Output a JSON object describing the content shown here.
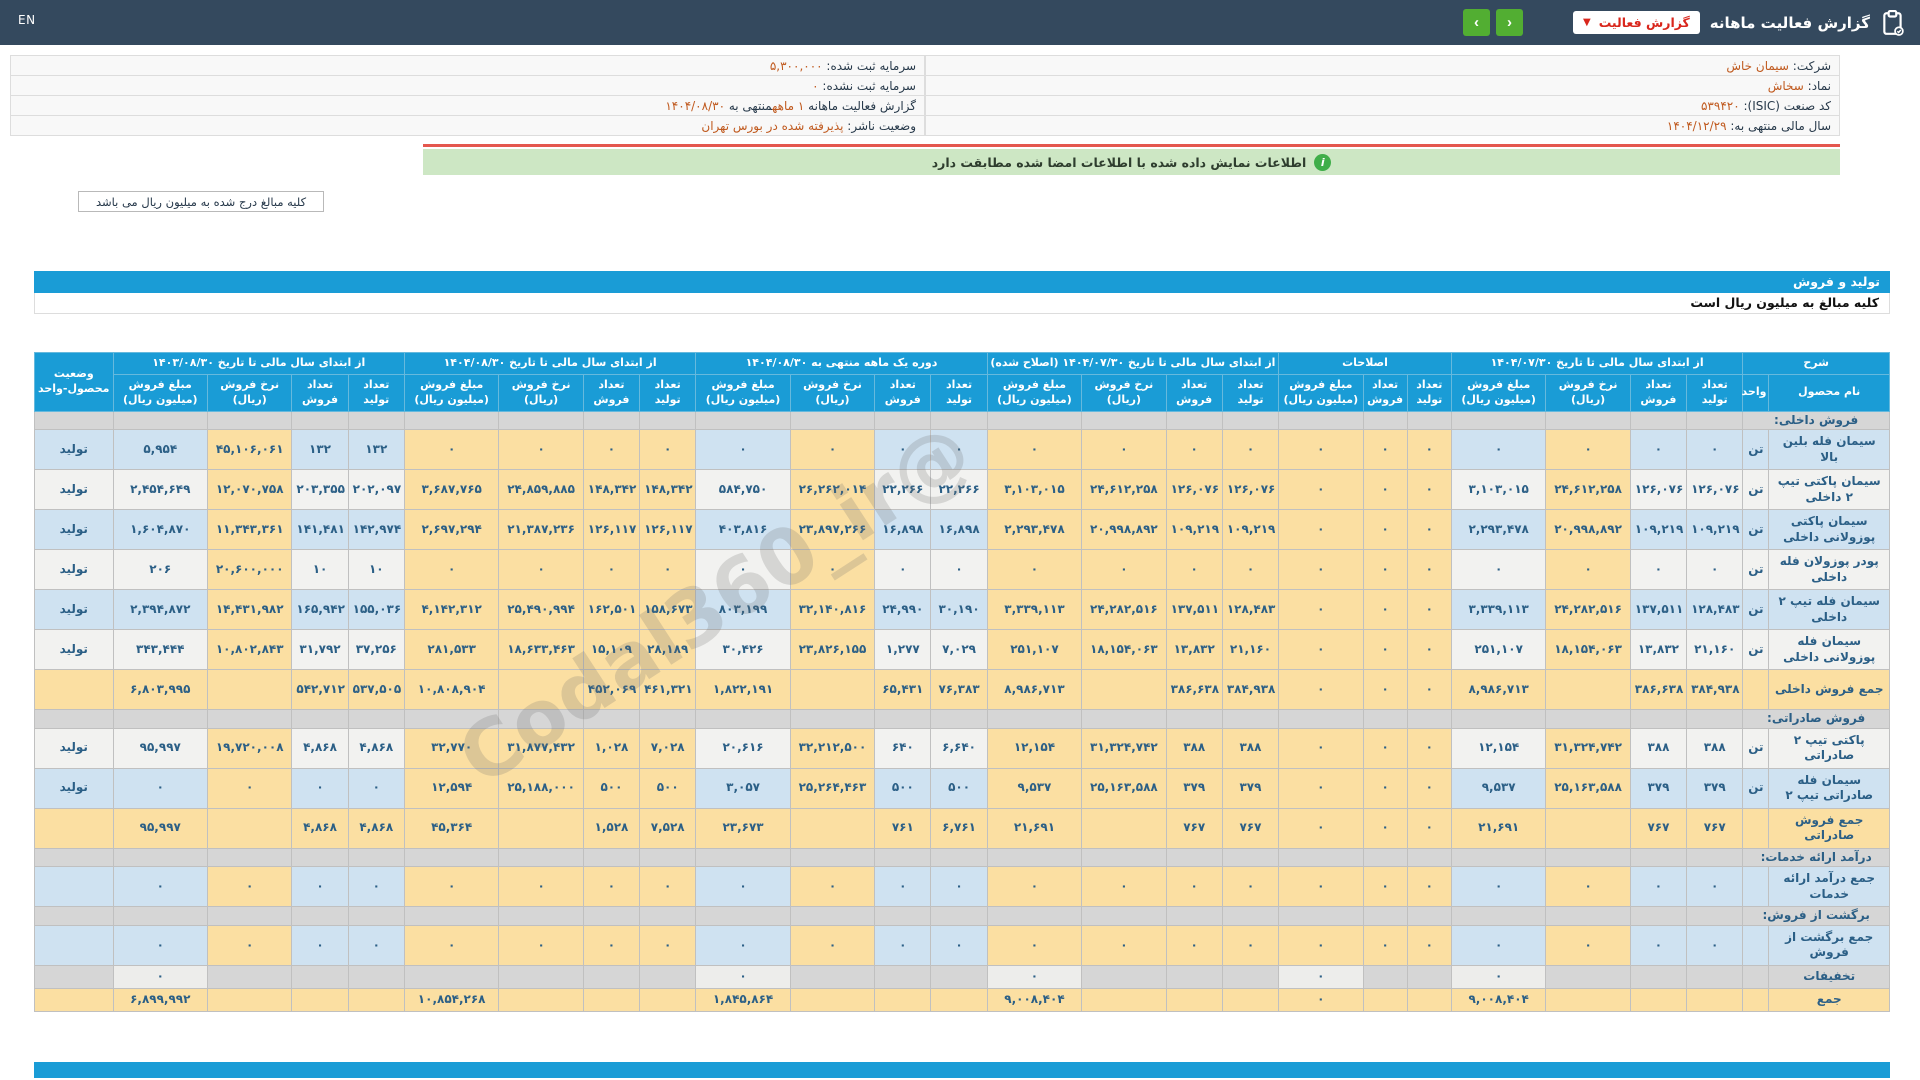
{
  "colors": {
    "topbar": "#34495e",
    "accent_blue": "#1a9cd6",
    "green_button": "#52ae32",
    "red_accent": "#d9261c",
    "orange_value": "#c05a1f",
    "row_blue": "#cfe2f1",
    "row_gray": "#f2f2f0",
    "cell_yellow": "#fbdfa2",
    "section_gray": "#d6d6d6",
    "green_bar": "#cde7c4",
    "red_line": "#e4574e"
  },
  "topbar": {
    "title": "گزارش فعالیت ماهانه",
    "dropdown_label": "گزارش فعالیت",
    "prev_label": "‹",
    "next_label": "›",
    "en_label": "EN"
  },
  "info": {
    "right": [
      {
        "label": "شرکت:",
        "value": "سیمان خاش"
      },
      {
        "label": "نماد:",
        "value": "سخاش"
      },
      {
        "label": "کد صنعت (ISIC):",
        "value": "۵۳۹۴۲۰"
      },
      {
        "label": "سال مالی منتهی به:",
        "value": "۱۴۰۴/۱۲/۲۹"
      }
    ],
    "left": [
      {
        "label": "سرمایه ثبت شده:",
        "value": "۵,۳۰۰,۰۰۰"
      },
      {
        "label": "سرمایه ثبت نشده:",
        "value": "۰"
      },
      {
        "parts": [
          {
            "t": "گزارش فعالیت ماهانه "
          },
          {
            "t": "۱ ماهه",
            "o": true
          },
          {
            "t": "منتهی به "
          },
          {
            "t": "۱۴۰۴/۰۸/۳۰",
            "o": true
          }
        ]
      },
      {
        "label": "وضعیت ناشر:",
        "value": "پذیرفته شده در بورس تهران"
      }
    ]
  },
  "signature_note": "اطلاعات نمایش داده شده با اطلاعات امضا شده مطابقت دارد",
  "info_icon": "i",
  "amounts_note_box": "کلیه مبالغ درج شده به میلیون ریال می باشد",
  "section_bar": "تولید و فروش",
  "table_note": "کلیه مبالغ به میلیون ریال است",
  "watermark": "@Codal360_ir",
  "table": {
    "header": {
      "sharh": "شرح",
      "name_col": "نام محصول",
      "unit_col": "واحد",
      "status_col": "وضعیت محصول-واحد",
      "sub4": [
        "تعداد تولید",
        "تعداد فروش",
        "نرخ فروش (ریال)",
        "مبلغ فروش (میلیون ریال)"
      ],
      "sub3": [
        "تعداد تولید",
        "تعداد فروش",
        "مبلغ فروش (میلیون ریال)"
      ],
      "groups": [
        {
          "key": "g07",
          "cols": 4,
          "label": "از ابتدای سال مالی تا تاریخ ۱۴۰۴/۰۷/۳۰"
        },
        {
          "key": "amd",
          "cols": 3,
          "label": "اصلاحات"
        },
        {
          "key": "g07c",
          "cols": 4,
          "label": "از ابتدای سال مالی تا تاریخ ۱۴۰۴/۰۷/۳۰ (اصلاح شده)"
        },
        {
          "key": "m1",
          "cols": 4,
          "label": "دوره یک ماهه منتهی به ۱۴۰۴/۰۸/۳۰"
        },
        {
          "key": "g08",
          "cols": 4,
          "label": "از ابتدای سال مالی تا تاریخ ۱۴۰۴/۰۸/۳۰"
        },
        {
          "key": "g03",
          "cols": 4,
          "label": "از ابتدای سال مالی تا تاریخ ۱۴۰۳/۰۸/۳۰"
        }
      ]
    },
    "rows": [
      {
        "type": "section",
        "name": "فروش داخلی:"
      },
      {
        "type": "data",
        "tone": "blue",
        "name": "سیمان فله بلین بالا",
        "unit": "تن",
        "status": "تولید",
        "g07": [
          "۰",
          "۰",
          "۰",
          "۰"
        ],
        "amd": [
          "۰",
          "۰",
          "۰"
        ],
        "g07c": [
          "۰",
          "۰",
          "۰",
          "۰"
        ],
        "m1": [
          "۰",
          "۰",
          "۰",
          "۰"
        ],
        "g08": [
          "۰",
          "۰",
          "۰",
          "۰"
        ],
        "g03": [
          "۱۳۲",
          "۱۳۲",
          "۴۵,۱۰۶,۰۶۱",
          "۵,۹۵۴"
        ]
      },
      {
        "type": "data",
        "tone": "gray",
        "name": "سیمان پاکتی تیپ ۲ داخلی",
        "unit": "تن",
        "status": "تولید",
        "g07": [
          "۱۲۶,۰۷۶",
          "۱۲۶,۰۷۶",
          "۲۴,۶۱۲,۲۵۸",
          "۳,۱۰۳,۰۱۵"
        ],
        "amd": [
          "۰",
          "۰",
          "۰"
        ],
        "g07c": [
          "۱۲۶,۰۷۶",
          "۱۲۶,۰۷۶",
          "۲۴,۶۱۲,۲۵۸",
          "۳,۱۰۳,۰۱۵"
        ],
        "m1": [
          "۲۲,۲۶۶",
          "۲۲,۲۶۶",
          "۲۶,۲۶۲,۰۱۴",
          "۵۸۴,۷۵۰"
        ],
        "g08": [
          "۱۴۸,۳۴۲",
          "۱۴۸,۳۴۲",
          "۲۴,۸۵۹,۸۸۵",
          "۳,۶۸۷,۷۶۵"
        ],
        "g03": [
          "۲۰۲,۰۹۷",
          "۲۰۳,۳۵۵",
          "۱۲,۰۷۰,۷۵۸",
          "۲,۴۵۴,۶۴۹"
        ]
      },
      {
        "type": "data",
        "tone": "blue",
        "name": "سیمان پاکتی پوزولانی داخلی",
        "unit": "تن",
        "status": "تولید",
        "g07": [
          "۱۰۹,۲۱۹",
          "۱۰۹,۲۱۹",
          "۲۰,۹۹۸,۸۹۲",
          "۲,۲۹۳,۴۷۸"
        ],
        "amd": [
          "۰",
          "۰",
          "۰"
        ],
        "g07c": [
          "۱۰۹,۲۱۹",
          "۱۰۹,۲۱۹",
          "۲۰,۹۹۸,۸۹۲",
          "۲,۲۹۳,۴۷۸"
        ],
        "m1": [
          "۱۶,۸۹۸",
          "۱۶,۸۹۸",
          "۲۳,۸۹۷,۲۶۶",
          "۴۰۳,۸۱۶"
        ],
        "g08": [
          "۱۲۶,۱۱۷",
          "۱۲۶,۱۱۷",
          "۲۱,۳۸۷,۲۳۶",
          "۲,۶۹۷,۲۹۴"
        ],
        "g03": [
          "۱۴۲,۹۷۴",
          "۱۴۱,۴۸۱",
          "۱۱,۳۴۳,۳۶۱",
          "۱,۶۰۴,۸۷۰"
        ]
      },
      {
        "type": "data",
        "tone": "gray",
        "name": "پودر پوزولان فله داخلی",
        "unit": "تن",
        "status": "تولید",
        "g07": [
          "۰",
          "۰",
          "۰",
          "۰"
        ],
        "amd": [
          "۰",
          "۰",
          "۰"
        ],
        "g07c": [
          "۰",
          "۰",
          "۰",
          "۰"
        ],
        "m1": [
          "۰",
          "۰",
          "۰",
          "۰"
        ],
        "g08": [
          "۰",
          "۰",
          "۰",
          "۰"
        ],
        "g03": [
          "۱۰",
          "۱۰",
          "۲۰,۶۰۰,۰۰۰",
          "۲۰۶"
        ]
      },
      {
        "type": "data",
        "tone": "blue",
        "name": "سیمان فله تیپ ۲ داخلی",
        "unit": "تن",
        "status": "تولید",
        "g07": [
          "۱۲۸,۴۸۳",
          "۱۳۷,۵۱۱",
          "۲۴,۲۸۲,۵۱۶",
          "۳,۳۳۹,۱۱۳"
        ],
        "amd": [
          "۰",
          "۰",
          "۰"
        ],
        "g07c": [
          "۱۲۸,۴۸۳",
          "۱۳۷,۵۱۱",
          "۲۴,۲۸۲,۵۱۶",
          "۳,۳۳۹,۱۱۳"
        ],
        "m1": [
          "۳۰,۱۹۰",
          "۲۴,۹۹۰",
          "۳۲,۱۴۰,۸۱۶",
          "۸۰۳,۱۹۹"
        ],
        "g08": [
          "۱۵۸,۶۷۳",
          "۱۶۲,۵۰۱",
          "۲۵,۴۹۰,۹۹۴",
          "۴,۱۴۲,۳۱۲"
        ],
        "g03": [
          "۱۵۵,۰۳۶",
          "۱۶۵,۹۴۲",
          "۱۴,۴۳۱,۹۸۲",
          "۲,۳۹۴,۸۷۲"
        ]
      },
      {
        "type": "data",
        "tone": "gray",
        "name": "سیمان فله پوزولانی داخلی",
        "unit": "تن",
        "status": "تولید",
        "g07": [
          "۲۱,۱۶۰",
          "۱۳,۸۳۲",
          "۱۸,۱۵۴,۰۶۳",
          "۲۵۱,۱۰۷"
        ],
        "amd": [
          "۰",
          "۰",
          "۰"
        ],
        "g07c": [
          "۲۱,۱۶۰",
          "۱۳,۸۳۲",
          "۱۸,۱۵۴,۰۶۳",
          "۲۵۱,۱۰۷"
        ],
        "m1": [
          "۷,۰۲۹",
          "۱,۲۷۷",
          "۲۳,۸۲۶,۱۵۵",
          "۳۰,۴۲۶"
        ],
        "g08": [
          "۲۸,۱۸۹",
          "۱۵,۱۰۹",
          "۱۸,۶۳۳,۴۶۳",
          "۲۸۱,۵۳۳"
        ],
        "g03": [
          "۳۷,۲۵۶",
          "۳۱,۷۹۲",
          "۱۰,۸۰۲,۸۴۳",
          "۳۴۳,۴۴۴"
        ]
      },
      {
        "type": "total",
        "name": "جمع فروش داخلی",
        "unit": "",
        "status": "",
        "g07": [
          "۳۸۴,۹۳۸",
          "۳۸۶,۶۳۸",
          "",
          "۸,۹۸۶,۷۱۳"
        ],
        "amd": [
          "۰",
          "۰",
          "۰"
        ],
        "g07c": [
          "۳۸۴,۹۳۸",
          "۳۸۶,۶۳۸",
          "",
          "۸,۹۸۶,۷۱۳"
        ],
        "m1": [
          "۷۶,۳۸۳",
          "۶۵,۴۳۱",
          "",
          "۱,۸۲۲,۱۹۱"
        ],
        "g08": [
          "۴۶۱,۳۲۱",
          "۴۵۲,۰۶۹",
          "",
          "۱۰,۸۰۸,۹۰۴"
        ],
        "g03": [
          "۵۳۷,۵۰۵",
          "۵۴۲,۷۱۲",
          "",
          "۶,۸۰۳,۹۹۵"
        ]
      },
      {
        "type": "section",
        "name": "فروش صادراتی:"
      },
      {
        "type": "data",
        "tone": "gray",
        "name": "پاکتی تیپ ۲ صادراتی",
        "unit": "تن",
        "status": "تولید",
        "g07": [
          "۳۸۸",
          "۳۸۸",
          "۳۱,۳۲۴,۷۴۲",
          "۱۲,۱۵۴"
        ],
        "amd": [
          "۰",
          "۰",
          "۰"
        ],
        "g07c": [
          "۳۸۸",
          "۳۸۸",
          "۳۱,۳۲۴,۷۴۲",
          "۱۲,۱۵۴"
        ],
        "m1": [
          "۶,۶۴۰",
          "۶۴۰",
          "۳۲,۲۱۲,۵۰۰",
          "۲۰,۶۱۶"
        ],
        "g08": [
          "۷,۰۲۸",
          "۱,۰۲۸",
          "۳۱,۸۷۷,۴۳۲",
          "۳۲,۷۷۰"
        ],
        "g03": [
          "۴,۸۶۸",
          "۴,۸۶۸",
          "۱۹,۷۲۰,۰۰۸",
          "۹۵,۹۹۷"
        ]
      },
      {
        "type": "data",
        "tone": "blue",
        "name": "سیمان فله صادراتی تیپ ۲",
        "unit": "تن",
        "status": "تولید",
        "g07": [
          "۳۷۹",
          "۳۷۹",
          "۲۵,۱۶۳,۵۸۸",
          "۹,۵۳۷"
        ],
        "amd": [
          "۰",
          "۰",
          "۰"
        ],
        "g07c": [
          "۳۷۹",
          "۳۷۹",
          "۲۵,۱۶۳,۵۸۸",
          "۹,۵۳۷"
        ],
        "m1": [
          "۵۰۰",
          "۵۰۰",
          "۲۵,۲۶۴,۴۶۳",
          "۳,۰۵۷"
        ],
        "g08": [
          "۵۰۰",
          "۵۰۰",
          "۲۵,۱۸۸,۰۰۰",
          "۱۲,۵۹۴"
        ],
        "g03": [
          "۰",
          "۰",
          "۰",
          "۰"
        ]
      },
      {
        "type": "total",
        "name": "جمع فروش صادراتی",
        "unit": "",
        "status": "",
        "g07": [
          "۷۶۷",
          "۷۶۷",
          "",
          "۲۱,۶۹۱"
        ],
        "amd": [
          "۰",
          "۰",
          "۰"
        ],
        "g07c": [
          "۷۶۷",
          "۷۶۷",
          "",
          "۲۱,۶۹۱"
        ],
        "m1": [
          "۶,۷۶۱",
          "۷۶۱",
          "",
          "۲۳,۶۷۳"
        ],
        "g08": [
          "۷,۵۲۸",
          "۱,۵۲۸",
          "",
          "۴۵,۳۶۴"
        ],
        "g03": [
          "۴,۸۶۸",
          "۴,۸۶۸",
          "",
          "۹۵,۹۹۷"
        ]
      },
      {
        "type": "section",
        "name": "درآمد ارائه خدمات:"
      },
      {
        "type": "data",
        "tone": "blue",
        "name": "جمع درآمد ارائه خدمات",
        "unit": "",
        "status": "",
        "g07": [
          "۰",
          "۰",
          "۰",
          "۰"
        ],
        "amd": [
          "۰",
          "۰",
          "۰"
        ],
        "g07c": [
          "۰",
          "۰",
          "۰",
          "۰"
        ],
        "m1": [
          "۰",
          "۰",
          "۰",
          "۰"
        ],
        "g08": [
          "۰",
          "۰",
          "۰",
          "۰"
        ],
        "g03": [
          "۰",
          "۰",
          "۰",
          "۰"
        ]
      },
      {
        "type": "section",
        "name": "برگشت از فروش:"
      },
      {
        "type": "data",
        "tone": "blue",
        "name": "جمع برگشت از فروش",
        "unit": "",
        "status": "",
        "g07": [
          "۰",
          "۰",
          "۰",
          "۰"
        ],
        "amd": [
          "۰",
          "۰",
          "۰"
        ],
        "g07c": [
          "۰",
          "۰",
          "۰",
          "۰"
        ],
        "m1": [
          "۰",
          "۰",
          "۰",
          "۰"
        ],
        "g08": [
          "۰",
          "۰",
          "۰",
          "۰"
        ],
        "g03": [
          "۰",
          "۰",
          "۰",
          "۰"
        ]
      },
      {
        "type": "discount",
        "name": "تخفیفات",
        "unit": "",
        "status": "",
        "g07": [
          "",
          "",
          "",
          "۰"
        ],
        "amd": [
          "",
          "",
          "۰"
        ],
        "g07c": [
          "",
          "",
          "",
          "۰"
        ],
        "m1": [
          "",
          "",
          "",
          "۰"
        ],
        "g08": [
          "",
          "",
          "",
          ""
        ],
        "g03": [
          "",
          "",
          "",
          "۰"
        ]
      },
      {
        "type": "grand",
        "name": "جمع",
        "unit": "",
        "status": "",
        "g07": [
          "",
          "",
          "",
          "۹,۰۰۸,۴۰۴"
        ],
        "amd": [
          "",
          "",
          "۰"
        ],
        "g07c": [
          "",
          "",
          "",
          "۹,۰۰۸,۴۰۴"
        ],
        "m1": [
          "",
          "",
          "",
          "۱,۸۴۵,۸۶۴"
        ],
        "g08": [
          "",
          "",
          "",
          "۱۰,۸۵۴,۲۶۸"
        ],
        "g03": [
          "",
          "",
          "",
          "۶,۸۹۹,۹۹۲"
        ]
      }
    ]
  }
}
